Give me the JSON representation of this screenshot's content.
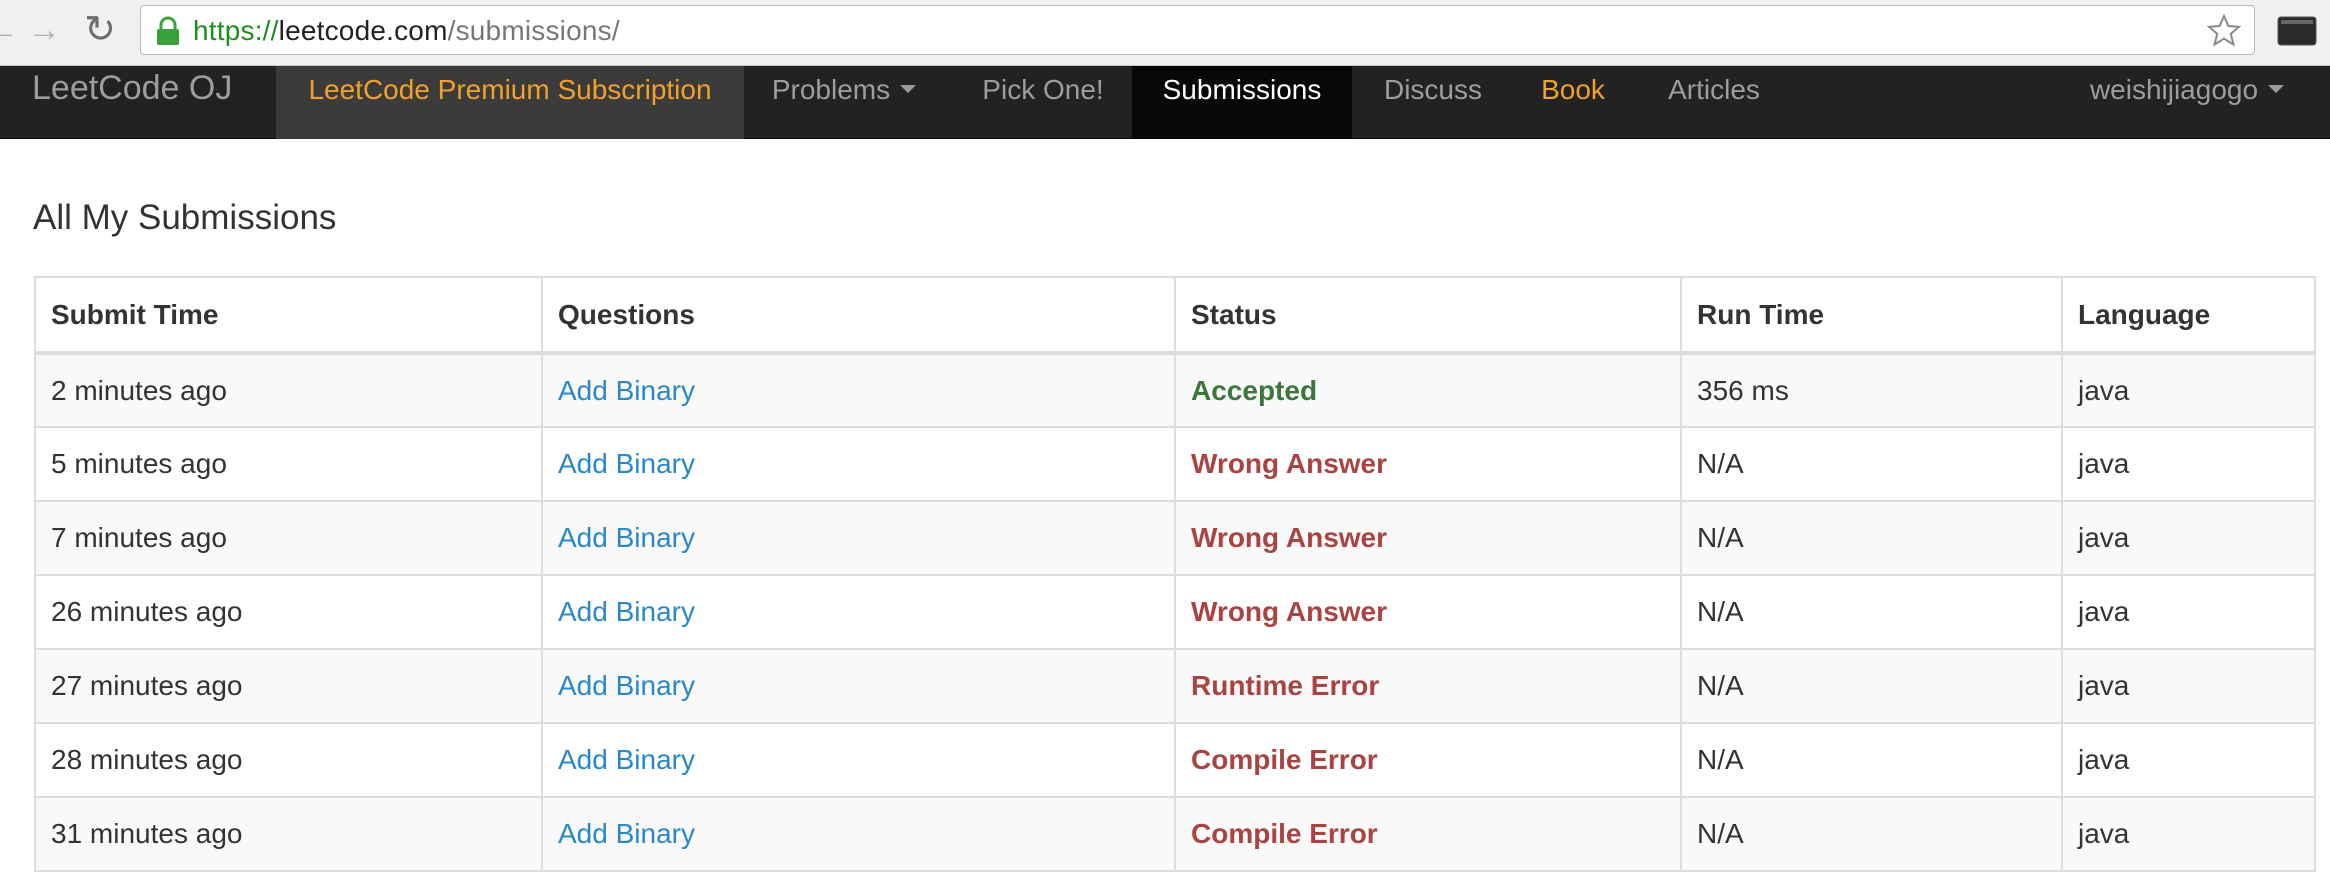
{
  "browser": {
    "url_scheme": "https://",
    "url_host": "leetcode.com",
    "url_path": "/submissions/"
  },
  "navbar": {
    "brand": "LeetCode OJ",
    "premium": "LeetCode Premium Subscription",
    "problems": "Problems",
    "pick_one": "Pick One!",
    "submissions": "Submissions",
    "discuss": "Discuss",
    "book": "Book",
    "articles": "Articles",
    "user": "weishijiagogo",
    "accent_color": "#f0a12a"
  },
  "page": {
    "title": "All My Submissions"
  },
  "table": {
    "headers": [
      "Submit Time",
      "Questions",
      "Status",
      "Run Time",
      "Language"
    ],
    "rows": [
      {
        "time": "2 minutes ago",
        "question": "Add Binary",
        "status": "Accepted",
        "status_type": "ok",
        "runtime": "356 ms",
        "language": "java"
      },
      {
        "time": "5 minutes ago",
        "question": "Add Binary",
        "status": "Wrong Answer",
        "status_type": "err",
        "runtime": "N/A",
        "language": "java"
      },
      {
        "time": "7 minutes ago",
        "question": "Add Binary",
        "status": "Wrong Answer",
        "status_type": "err",
        "runtime": "N/A",
        "language": "java"
      },
      {
        "time": "26 minutes ago",
        "question": "Add Binary",
        "status": "Wrong Answer",
        "status_type": "err",
        "runtime": "N/A",
        "language": "java"
      },
      {
        "time": "27 minutes ago",
        "question": "Add Binary",
        "status": "Runtime Error",
        "status_type": "err",
        "runtime": "N/A",
        "language": "java"
      },
      {
        "time": "28 minutes ago",
        "question": "Add Binary",
        "status": "Compile Error",
        "status_type": "err",
        "runtime": "N/A",
        "language": "java"
      },
      {
        "time": "31 minutes ago",
        "question": "Add Binary",
        "status": "Compile Error",
        "status_type": "err",
        "runtime": "N/A",
        "language": "java"
      }
    ],
    "status_colors": {
      "ok": "#3c763d",
      "err": "#a94442"
    }
  }
}
